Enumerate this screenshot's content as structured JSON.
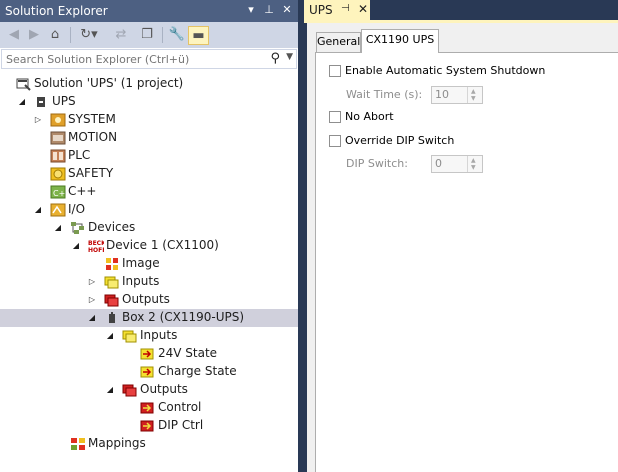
{
  "solution_explorer": {
    "title": "Solution Explorer",
    "title_buttons": [
      "▾",
      "⊥",
      "✕"
    ],
    "search_placeholder": "Search Solution Explorer (Ctrl+ü)",
    "tree": [
      {
        "label": "Solution 'UPS' (1 project)",
        "icon": "solution-icon",
        "indent": 0,
        "expander": "none"
      },
      {
        "label": "UPS",
        "icon": "project-icon",
        "indent": 1,
        "expander": "open"
      },
      {
        "label": "SYSTEM",
        "icon": "system-icon",
        "indent": 2,
        "expander": "closed"
      },
      {
        "label": "MOTION",
        "icon": "motion-icon",
        "indent": 2,
        "expander": "none"
      },
      {
        "label": "PLC",
        "icon": "plc-icon",
        "indent": 2,
        "expander": "none"
      },
      {
        "label": "SAFETY",
        "icon": "safety-icon",
        "indent": 2,
        "expander": "none"
      },
      {
        "label": "C++",
        "icon": "cpp-icon",
        "indent": 2,
        "expander": "none"
      },
      {
        "label": "I/O",
        "icon": "io-icon",
        "indent": 2,
        "expander": "open"
      },
      {
        "label": "Devices",
        "icon": "devices-icon",
        "indent": 3,
        "expander": "open"
      },
      {
        "label": "Device 1 (CX1100)",
        "icon": "beckhoff-device-icon",
        "indent": 4,
        "expander": "open"
      },
      {
        "label": "Image",
        "icon": "image-icon",
        "indent": 5,
        "expander": "none"
      },
      {
        "label": "Inputs",
        "icon": "inputs-icon",
        "indent": 5,
        "expander": "closed"
      },
      {
        "label": "Outputs",
        "icon": "outputs-icon",
        "indent": 5,
        "expander": "closed"
      },
      {
        "label": "Box 2 (CX1190-UPS)",
        "icon": "box-icon",
        "indent": 5,
        "expander": "open",
        "selected": true
      },
      {
        "label": "Inputs",
        "icon": "inputs-icon",
        "indent": 6,
        "expander": "open"
      },
      {
        "label": "24V State",
        "icon": "input-var-icon",
        "indent": 7,
        "expander": "none"
      },
      {
        "label": "Charge State",
        "icon": "input-var-icon",
        "indent": 7,
        "expander": "none"
      },
      {
        "label": "Outputs",
        "icon": "outputs-icon",
        "indent": 6,
        "expander": "open"
      },
      {
        "label": "Control",
        "icon": "output-var-icon",
        "indent": 7,
        "expander": "none"
      },
      {
        "label": "DIP Ctrl",
        "icon": "output-var-icon",
        "indent": 7,
        "expander": "none"
      },
      {
        "label": "Mappings",
        "icon": "mappings-icon",
        "indent": 3,
        "expander": "none"
      }
    ]
  },
  "document_tab": {
    "title": "UPS",
    "pin": "⊣",
    "close": "✕"
  },
  "editor": {
    "tabs": [
      {
        "label": "General",
        "active": false
      },
      {
        "label": "CX1190 UPS",
        "active": true
      }
    ],
    "enable_shutdown": {
      "label": "Enable Automatic System Shutdown",
      "checked": false
    },
    "wait_time": {
      "label": "Wait Time (s):",
      "value": "10"
    },
    "no_abort": {
      "label": "No Abort",
      "checked": false
    },
    "override_dip": {
      "label": "Override DIP Switch",
      "checked": false
    },
    "dip_switch": {
      "label": "DIP Switch:",
      "value": "0"
    }
  }
}
